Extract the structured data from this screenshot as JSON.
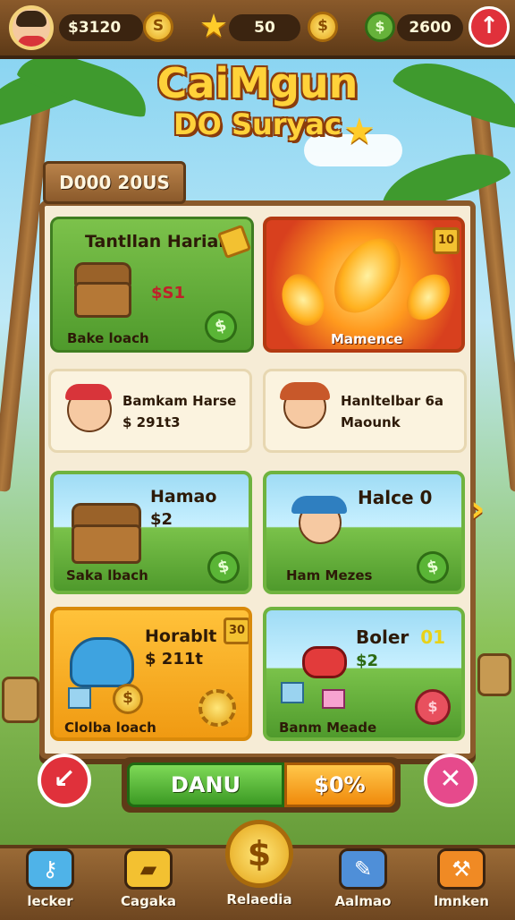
{
  "top_bar": {
    "currency1": "$3120",
    "stars": "50",
    "currency3": "2600"
  },
  "title": {
    "line1": "CaiMgun",
    "line2": "DO Suryac"
  },
  "board": {
    "banner": "D000 20US"
  },
  "cards": [
    {
      "title": "Tantllan Harian",
      "price": "$S1",
      "label": "Bake loach"
    },
    {
      "tag": "10",
      "label": "Mamence"
    },
    {
      "title": "Bamkam Harse",
      "price": "$ 291t3"
    },
    {
      "title": "Hanltelbar 6a",
      "subtitle": "Maounk"
    },
    {
      "title": "Hamao",
      "price": "$2",
      "label": "Saka lbach"
    },
    {
      "title": "Halce 0",
      "label": "Ham Mezes"
    },
    {
      "title": "Horablt",
      "price": "$ 211t",
      "label": "Clolba loach",
      "tag": "30"
    },
    {
      "title": "Boler",
      "title_suffix": "01",
      "price": "$2",
      "label": "Banm Meade"
    }
  ],
  "actions": {
    "primary_label": "DANU",
    "secondary_label": "$0%"
  },
  "nav": [
    {
      "label": "lecker"
    },
    {
      "label": "Cagaka"
    },
    {
      "label": "Relaedia"
    },
    {
      "label": "Aalmao"
    },
    {
      "label": "lmnken"
    }
  ],
  "colors": {
    "accent_gold": "#ffd23a",
    "wood": "#8a5a2b",
    "green": "#4f9a2c",
    "exit_red": "#e0313b"
  }
}
